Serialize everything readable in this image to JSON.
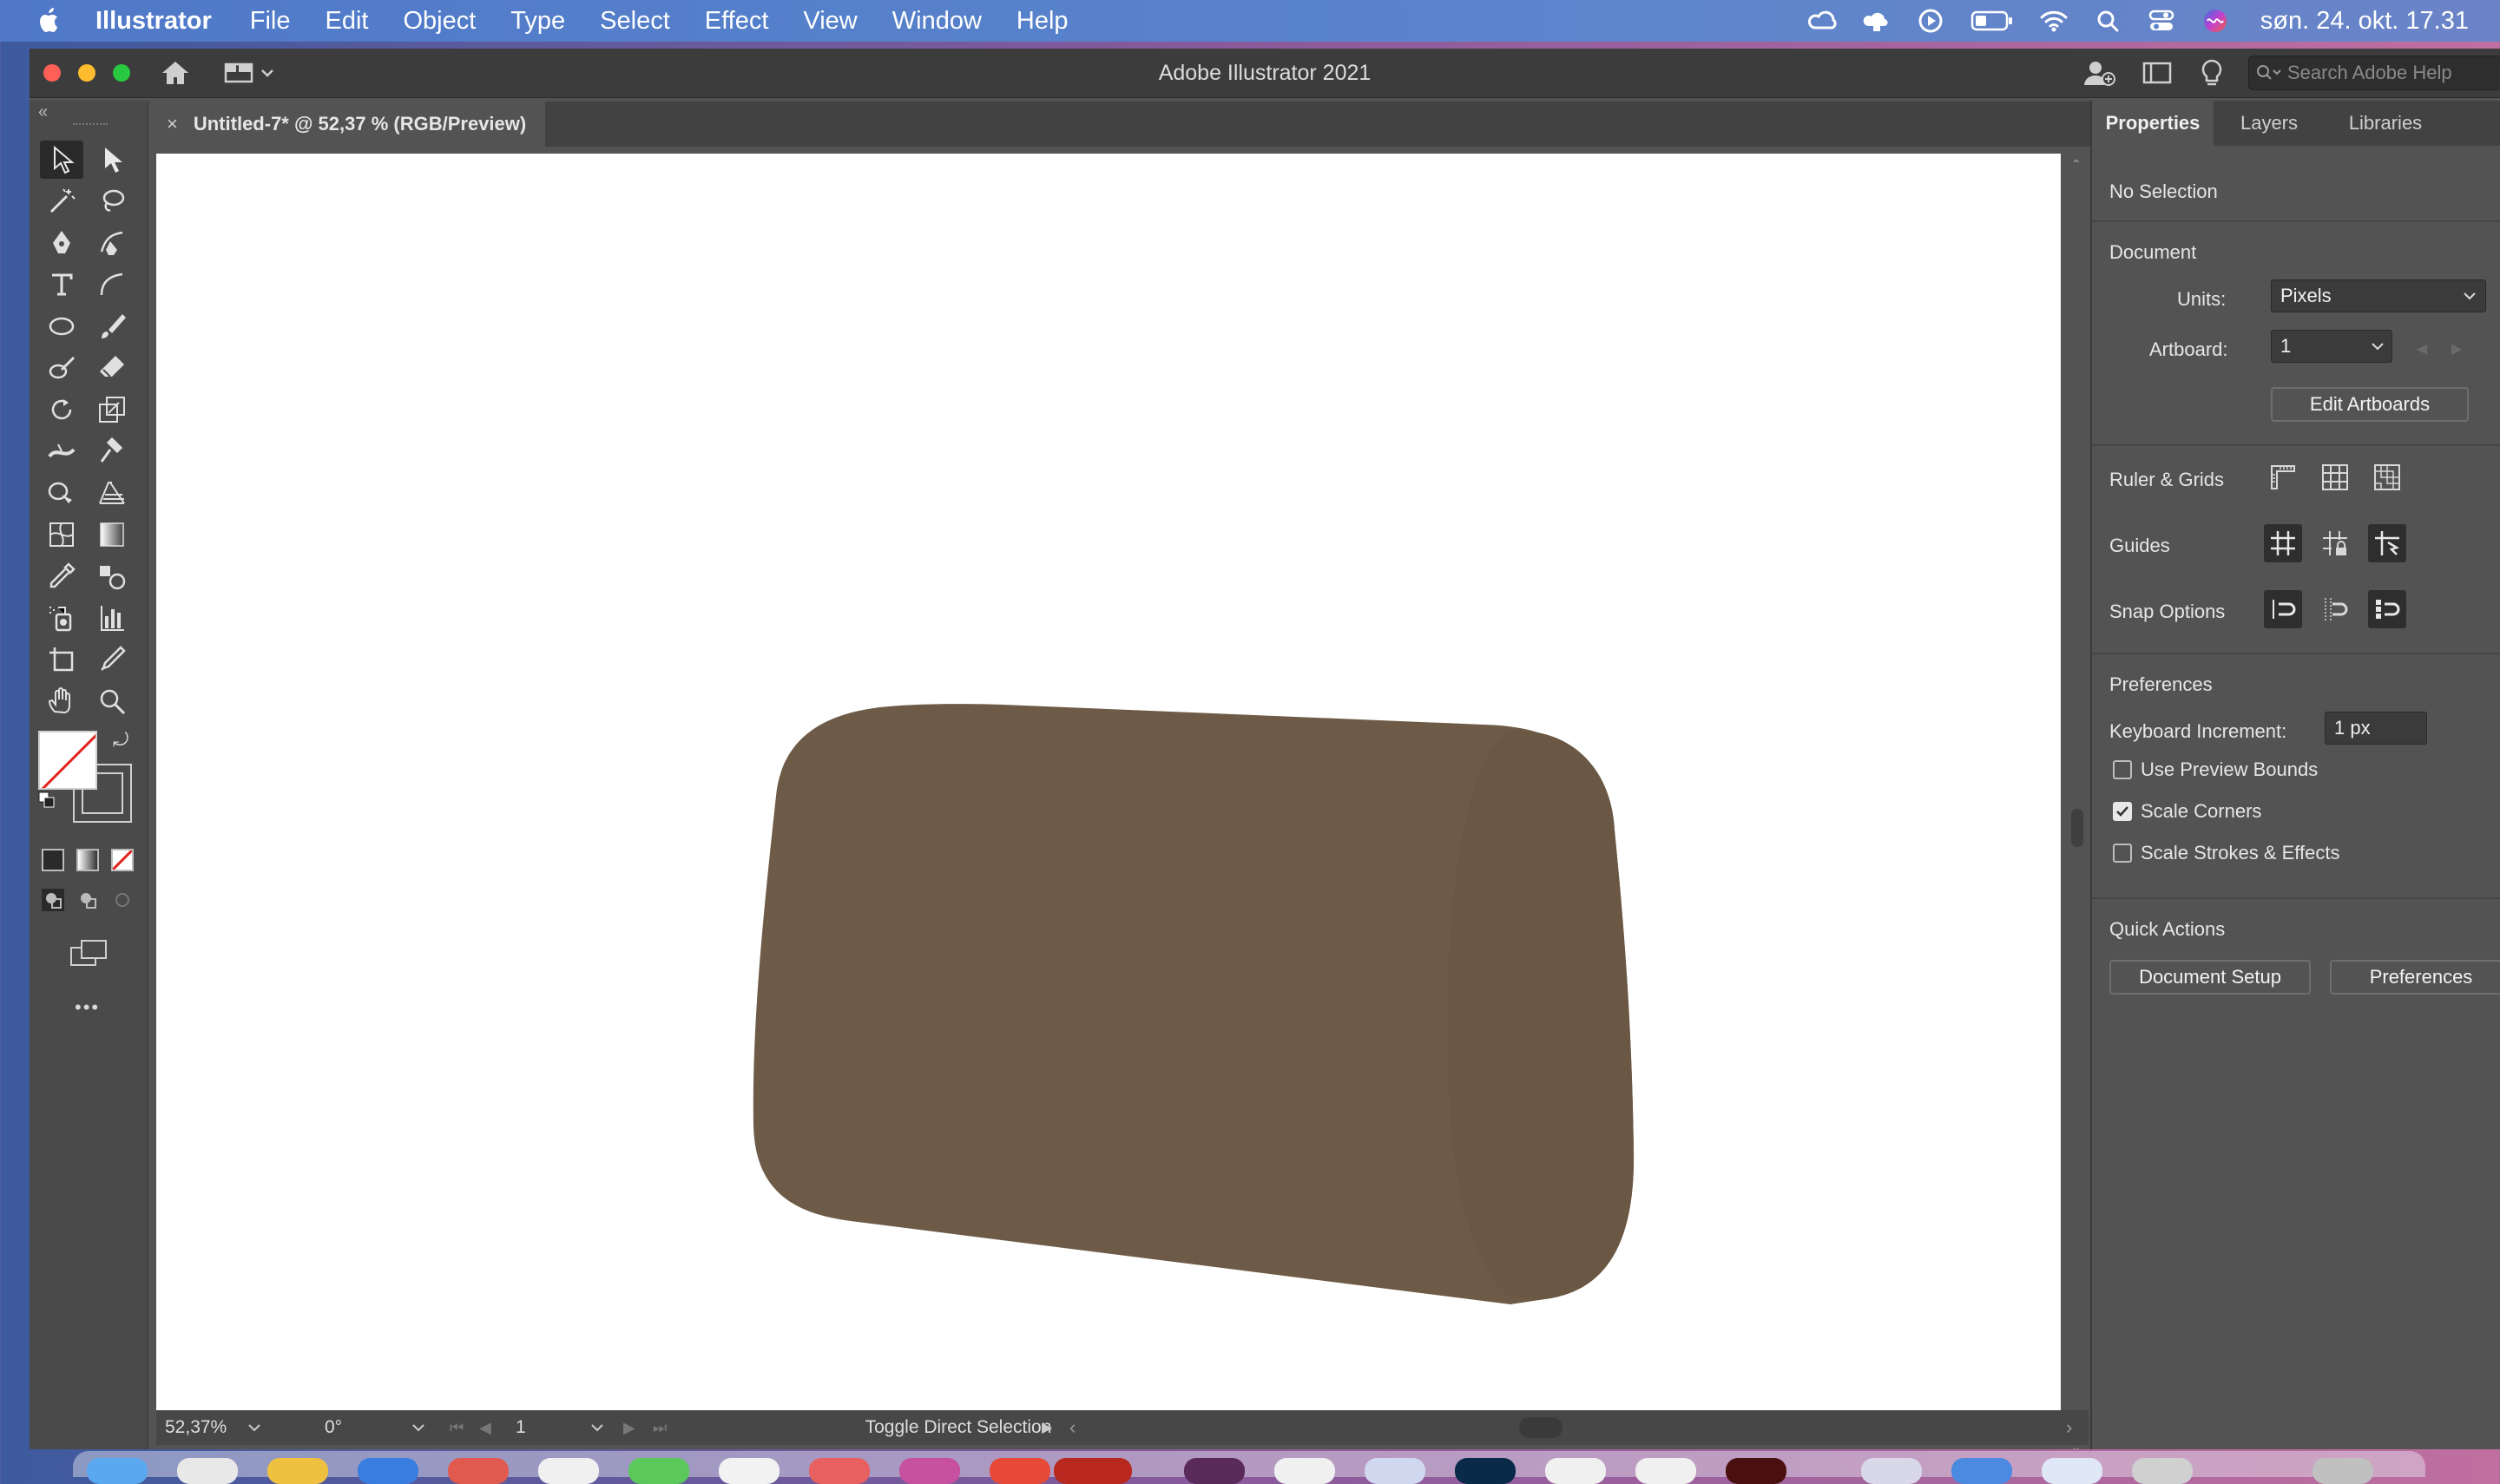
{
  "menubar": {
    "app_name": "Illustrator",
    "items": [
      "File",
      "Edit",
      "Object",
      "Type",
      "Select",
      "Effect",
      "View",
      "Window",
      "Help"
    ],
    "clock": "søn. 24. okt. 17.31"
  },
  "window": {
    "title": "Adobe Illustrator 2021",
    "search_placeholder": "Search Adobe Help"
  },
  "document": {
    "tab_label": "Untitled-7* @ 52,37 % (RGB/Preview)",
    "close_glyph": "×",
    "shape_color": "#6e5b47"
  },
  "statusbar": {
    "zoom": "52,37%",
    "rotation": "0°",
    "artboard": "1",
    "tool_hint": "Toggle Direct Selection"
  },
  "panel": {
    "tabs": [
      "Properties",
      "Layers",
      "Libraries"
    ],
    "selection": "No Selection",
    "document_heading": "Document",
    "units_label": "Units:",
    "units_value": "Pixels",
    "artboard_label": "Artboard:",
    "artboard_value": "1",
    "edit_artboards": "Edit Artboards",
    "ruler_grids": "Ruler & Grids",
    "guides": "Guides",
    "snap_options": "Snap Options",
    "preferences_heading": "Preferences",
    "keyboard_increment_label": "Keyboard Increment:",
    "keyboard_increment_value": "1 px",
    "use_preview_bounds": "Use Preview Bounds",
    "use_preview_bounds_checked": false,
    "scale_corners": "Scale Corners",
    "scale_corners_checked": true,
    "scale_strokes": "Scale Strokes & Effects",
    "scale_strokes_checked": false,
    "quick_actions": "Quick Actions",
    "document_setup": "Document Setup",
    "preferences_button": "Preferences"
  },
  "toolbar": {
    "more_tools": "•••"
  }
}
